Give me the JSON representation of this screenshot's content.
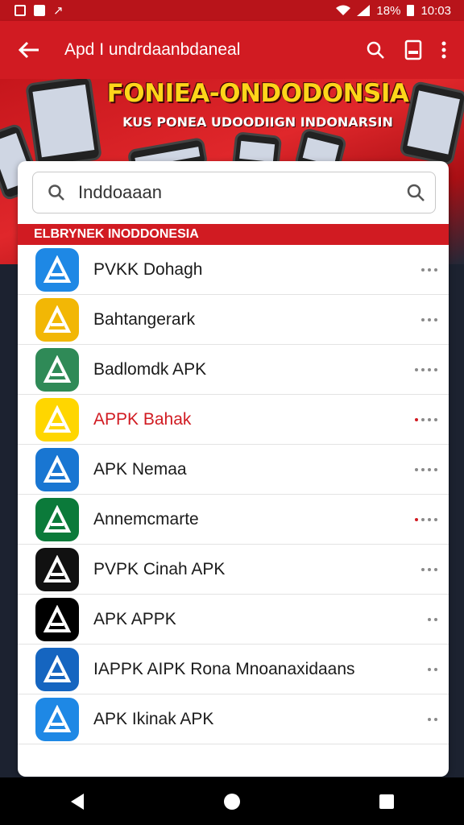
{
  "status_bar": {
    "battery": "18%",
    "time": "10:03"
  },
  "app_bar": {
    "title": "Apd I undrdaanbdaneal"
  },
  "banner": {
    "title": "FONIEA-ONDODONSIA",
    "subtitle": "KUS PONEA UDOODIIGN INDONARSIN"
  },
  "search": {
    "value": "Inddoaaan"
  },
  "section": {
    "label": "ELBRYNEK INODDONESIA"
  },
  "apps": [
    {
      "label": "PVKK Dohagh",
      "icon": "app-store-a-icon",
      "color": "#1e88e5",
      "dots": 3
    },
    {
      "label": "Bahtangerark",
      "icon": "black-ai-icon",
      "color": "#f2b705",
      "dots": 3
    },
    {
      "label": "Badlomdk APK",
      "icon": "green-play-icon",
      "color": "#2f8a57",
      "dots": 4
    },
    {
      "label": "APPK Bahak",
      "icon": "yellow-apy-icon",
      "color": "#ffd600",
      "dots": 4,
      "highlight": true
    },
    {
      "label": "APK Nemaa",
      "icon": "blue-sail-icon",
      "color": "#1976d2",
      "dots": 4
    },
    {
      "label": "Annemcmarte",
      "icon": "green-infinity-icon",
      "color": "#0b7a3a",
      "dots": 4
    },
    {
      "label": "PVPK Cinah APK",
      "icon": "red-triangle-icon",
      "color": "#111111",
      "dots": 3
    },
    {
      "label": "APK APPK",
      "icon": "red-shield-icon",
      "color": "#000000",
      "dots": 2
    },
    {
      "label": "IAPPK AIPK  Rona Mnoanaxidaans",
      "icon": "blue-a-icon",
      "color": "#1565c0",
      "dots": 2
    },
    {
      "label": "APK Ikinak APK",
      "icon": "gradient-a-icon",
      "color": "#1e88e5",
      "dots": 2
    }
  ]
}
